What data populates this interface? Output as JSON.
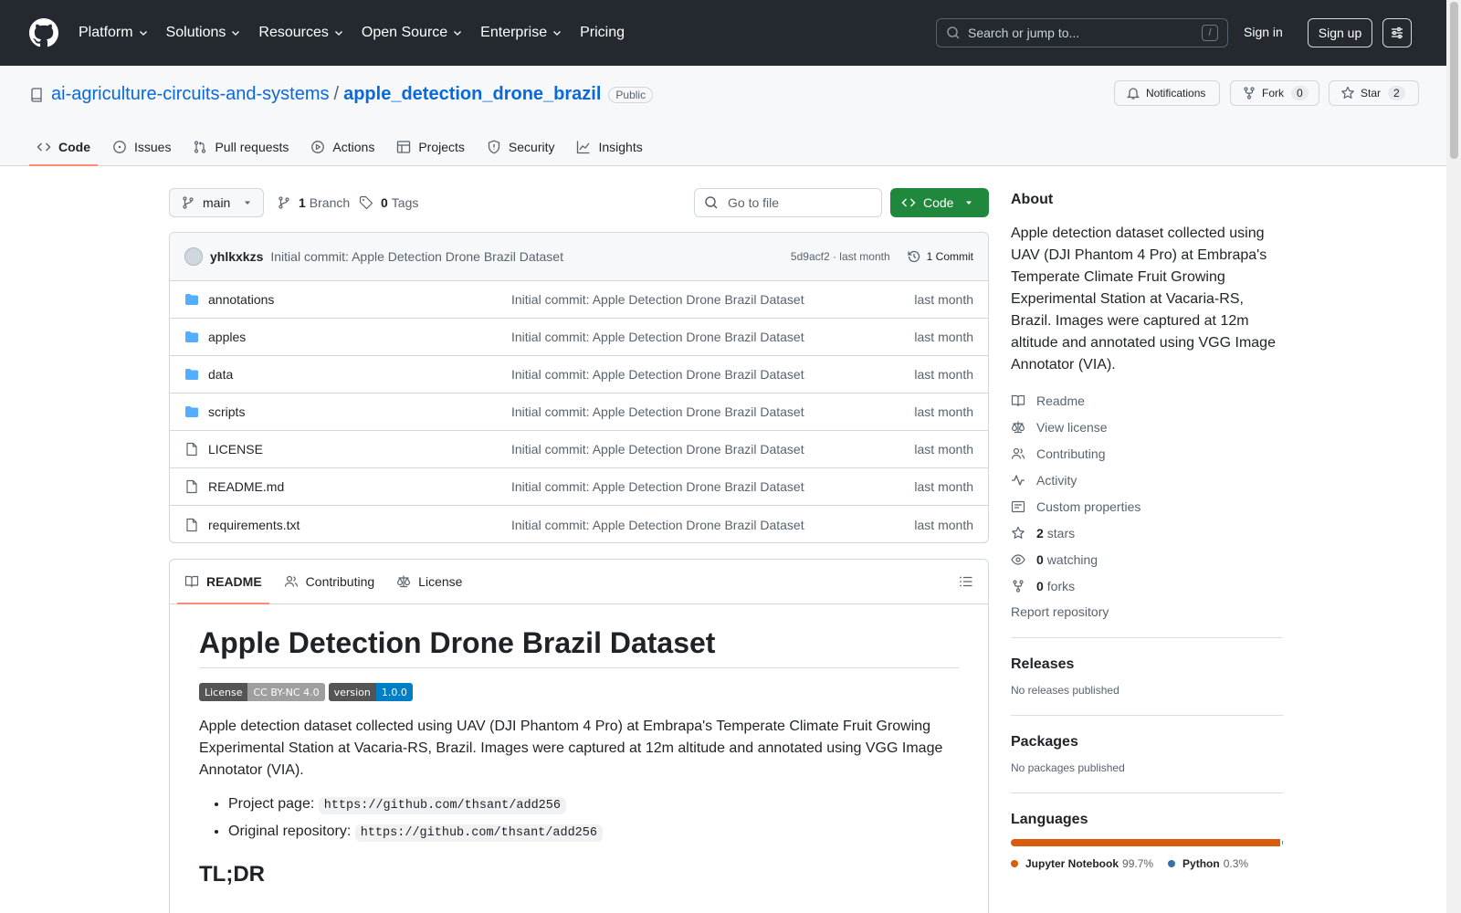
{
  "header": {
    "nav": [
      "Platform",
      "Solutions",
      "Resources",
      "Open Source",
      "Enterprise",
      "Pricing"
    ],
    "search_placeholder": "Search or jump to...",
    "search_shortcut": "/",
    "sign_in": "Sign in",
    "sign_up": "Sign up"
  },
  "repo": {
    "owner": "ai-agriculture-circuits-and-systems",
    "separator": "/",
    "name": "apple_detection_drone_brazil",
    "visibility": "Public",
    "notifications_label": "Notifications",
    "fork_label": "Fork",
    "fork_count": "0",
    "star_label": "Star",
    "star_count": "2",
    "tabs": [
      "Code",
      "Issues",
      "Pull requests",
      "Actions",
      "Projects",
      "Security",
      "Insights"
    ]
  },
  "browser": {
    "branch": "main",
    "branch_count": "1",
    "branch_label": "Branch",
    "tag_count": "0",
    "tag_label": "Tags",
    "goto_placeholder": "Go to file",
    "code_label": "Code",
    "commit": {
      "author": "yhlkxkzs",
      "message": "Initial commit: Apple Detection Drone Brazil Dataset",
      "sha_time": "5d9acf2 · last month",
      "count": "1 Commit"
    },
    "files": [
      {
        "name": "annotations",
        "type": "dir",
        "message": "Initial commit: Apple Detection Drone Brazil Dataset",
        "date": "last month"
      },
      {
        "name": "apples",
        "type": "dir",
        "message": "Initial commit: Apple Detection Drone Brazil Dataset",
        "date": "last month"
      },
      {
        "name": "data",
        "type": "dir",
        "message": "Initial commit: Apple Detection Drone Brazil Dataset",
        "date": "last month"
      },
      {
        "name": "scripts",
        "type": "dir",
        "message": "Initial commit: Apple Detection Drone Brazil Dataset",
        "date": "last month"
      },
      {
        "name": "LICENSE",
        "type": "file",
        "message": "Initial commit: Apple Detection Drone Brazil Dataset",
        "date": "last month"
      },
      {
        "name": "README.md",
        "type": "file",
        "message": "Initial commit: Apple Detection Drone Brazil Dataset",
        "date": "last month"
      },
      {
        "name": "requirements.txt",
        "type": "file",
        "message": "Initial commit: Apple Detection Drone Brazil Dataset",
        "date": "last month"
      }
    ]
  },
  "readme": {
    "tabs": [
      "README",
      "Contributing",
      "License"
    ],
    "title": "Apple Detection Drone Brazil Dataset",
    "badges": [
      {
        "left": "License",
        "right": "CC BY-NC 4.0",
        "color": "#9f9f9f"
      },
      {
        "left": "version",
        "right": "1.0.0",
        "color": "#007ec6"
      }
    ],
    "paragraph": "Apple detection dataset collected using UAV (DJI Phantom 4 Pro) at Embrapa's Temperate Climate Fruit Growing Experimental Station at Vacaria-RS, Brazil. Images were captured at 12m altitude and annotated using VGG Image Annotator (VIA).",
    "links": [
      {
        "label": "Project page:",
        "url": "https://github.com/thsant/add256"
      },
      {
        "label": "Original repository:",
        "url": "https://github.com/thsant/add256"
      }
    ],
    "h2": "TL;DR"
  },
  "sidebar": {
    "about_title": "About",
    "description": "Apple detection dataset collected using UAV (DJI Phantom 4 Pro) at Embrapa's Temperate Climate Fruit Growing Experimental Station at Vacaria-RS, Brazil. Images were captured at 12m altitude and annotated using VGG Image Annotator (VIA).",
    "links": [
      "Readme",
      "View license",
      "Contributing",
      "Activity",
      "Custom properties"
    ],
    "stars_count": "2",
    "stars_label": "stars",
    "watching_count": "0",
    "watching_label": "watching",
    "forks_count": "0",
    "forks_label": "forks",
    "report": "Report repository",
    "releases_title": "Releases",
    "releases_text": "No releases published",
    "packages_title": "Packages",
    "packages_text": "No packages published",
    "languages_title": "Languages",
    "languages": [
      {
        "name": "Jupyter Notebook",
        "percent": "99.7%",
        "value": 99.7,
        "color": "#DA5B0B"
      },
      {
        "name": "Python",
        "percent": "0.3%",
        "value": 0.3,
        "color": "#3572A5"
      }
    ]
  }
}
